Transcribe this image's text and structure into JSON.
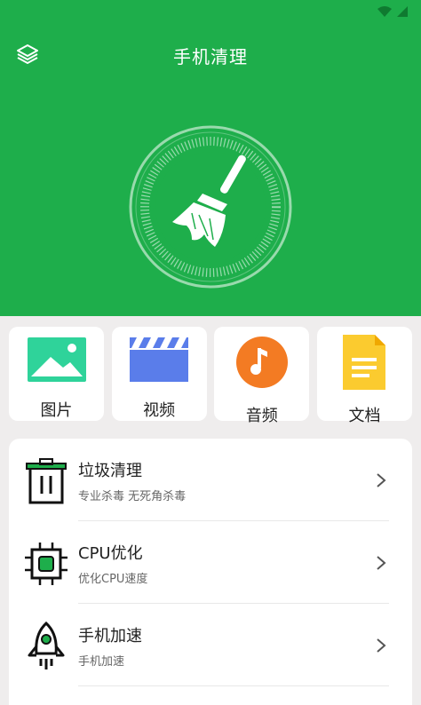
{
  "app": {
    "title": "手机清理"
  },
  "status": {
    "icons": [
      "wifi-icon",
      "signal-icon"
    ]
  },
  "colors": {
    "primary": "#1eae4b",
    "accent": "#1eae4b",
    "background": "#efeded"
  },
  "clean_button": {
    "icon": "broom-icon"
  },
  "categories": [
    {
      "label": "图片",
      "icon": "picture-icon"
    },
    {
      "label": "视频",
      "icon": "clapperboard-icon"
    },
    {
      "label": "音频",
      "icon": "music-note-icon"
    },
    {
      "label": "文档",
      "icon": "document-icon"
    }
  ],
  "tools": [
    {
      "title": "垃圾清理",
      "subtitle": "专业杀毒 无死角杀毒",
      "icon": "trash-bin-icon"
    },
    {
      "title": "CPU优化",
      "subtitle": "优化CPU速度",
      "icon": "cpu-chip-icon"
    },
    {
      "title": "手机加速",
      "subtitle": "手机加速",
      "icon": "rocket-icon"
    }
  ]
}
